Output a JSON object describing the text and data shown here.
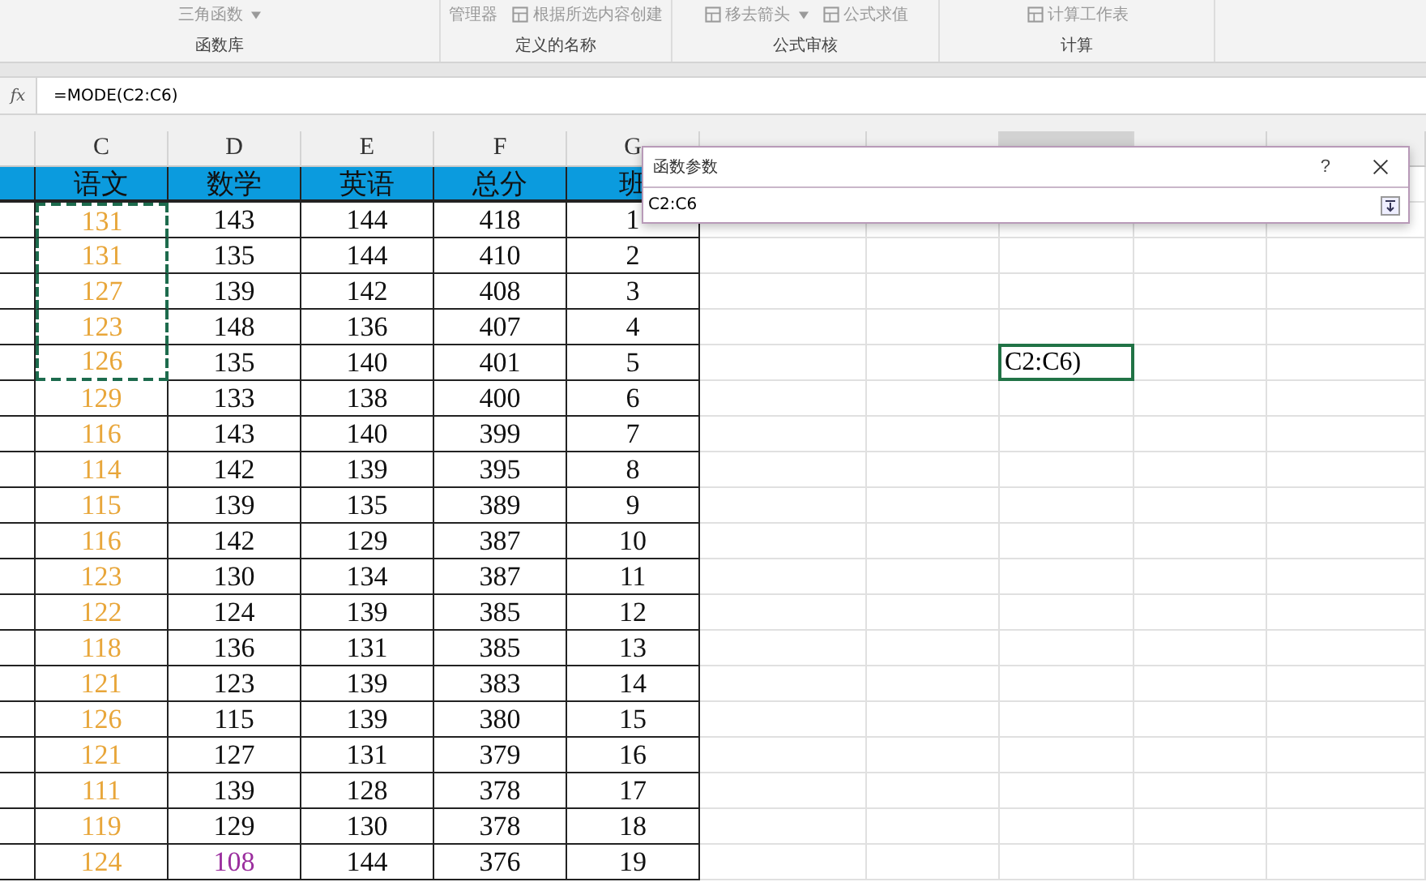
{
  "ribbon": {
    "groups": [
      {
        "label": "函数库",
        "items": [
          {
            "kind": "dropdown",
            "label": "三角函数"
          }
        ]
      },
      {
        "label": "定义的名称",
        "items": [
          {
            "kind": "plain",
            "label": "管理器"
          },
          {
            "kind": "icon",
            "label": "根据所选内容创建"
          }
        ]
      },
      {
        "label": "公式审核",
        "items": [
          {
            "kind": "dropdown-icon",
            "label": "移去箭头"
          },
          {
            "kind": "icon",
            "label": "公式求值"
          }
        ]
      },
      {
        "label": "计算",
        "items": [
          {
            "kind": "icon",
            "label": "计算工作表"
          }
        ]
      }
    ]
  },
  "formula_bar": {
    "fx": "fx",
    "formula": "=MODE(C2:C6)"
  },
  "columns": [
    {
      "selected": false
    },
    {
      "label": "C",
      "selected": false
    },
    {
      "label": "D",
      "selected": false
    },
    {
      "label": "E",
      "selected": false
    },
    {
      "label": "F",
      "selected": false
    },
    {
      "label": "G",
      "selected": false
    },
    {
      "selected": false
    },
    {
      "selected": false
    },
    {
      "selected": true
    },
    {
      "selected": false
    },
    {
      "selected": false
    }
  ],
  "header_row": [
    "语文",
    "数学",
    "英语",
    "总分",
    "班"
  ],
  "rows": [
    {
      "cells": [
        "131",
        "143",
        "144",
        "418",
        "1"
      ],
      "in_reference": true,
      "math_highlight": false
    },
    {
      "cells": [
        "131",
        "135",
        "144",
        "410",
        "2"
      ],
      "in_reference": true,
      "math_highlight": false
    },
    {
      "cells": [
        "127",
        "139",
        "142",
        "408",
        "3"
      ],
      "in_reference": true,
      "math_highlight": false
    },
    {
      "cells": [
        "123",
        "148",
        "136",
        "407",
        "4"
      ],
      "in_reference": true,
      "math_highlight": false
    },
    {
      "cells": [
        "126",
        "135",
        "140",
        "401",
        "5"
      ],
      "in_reference": true,
      "math_highlight": false,
      "editing_text": "C2:C6)"
    },
    {
      "cells": [
        "129",
        "133",
        "138",
        "400",
        "6"
      ],
      "in_reference": false,
      "math_highlight": false
    },
    {
      "cells": [
        "116",
        "143",
        "140",
        "399",
        "7"
      ],
      "in_reference": false,
      "math_highlight": false
    },
    {
      "cells": [
        "114",
        "142",
        "139",
        "395",
        "8"
      ],
      "in_reference": false,
      "math_highlight": false
    },
    {
      "cells": [
        "115",
        "139",
        "135",
        "389",
        "9"
      ],
      "in_reference": false,
      "math_highlight": false
    },
    {
      "cells": [
        "116",
        "142",
        "129",
        "387",
        "10"
      ],
      "in_reference": false,
      "math_highlight": false
    },
    {
      "cells": [
        "123",
        "130",
        "134",
        "387",
        "11"
      ],
      "in_reference": false,
      "math_highlight": false
    },
    {
      "cells": [
        "122",
        "124",
        "139",
        "385",
        "12"
      ],
      "in_reference": false,
      "math_highlight": false
    },
    {
      "cells": [
        "118",
        "136",
        "131",
        "385",
        "13"
      ],
      "in_reference": false,
      "math_highlight": false
    },
    {
      "cells": [
        "121",
        "123",
        "139",
        "383",
        "14"
      ],
      "in_reference": false,
      "math_highlight": false
    },
    {
      "cells": [
        "126",
        "115",
        "139",
        "380",
        "15"
      ],
      "in_reference": false,
      "math_highlight": false
    },
    {
      "cells": [
        "121",
        "127",
        "131",
        "379",
        "16"
      ],
      "in_reference": false,
      "math_highlight": false
    },
    {
      "cells": [
        "111",
        "139",
        "128",
        "378",
        "17"
      ],
      "in_reference": false,
      "math_highlight": false
    },
    {
      "cells": [
        "119",
        "129",
        "130",
        "378",
        "18"
      ],
      "in_reference": false,
      "math_highlight": false
    },
    {
      "cells": [
        "124",
        "108",
        "144",
        "376",
        "19"
      ],
      "in_reference": false,
      "math_highlight": true
    }
  ],
  "dialog": {
    "title": "函数参数",
    "help": "?",
    "value": "C2:C6"
  }
}
